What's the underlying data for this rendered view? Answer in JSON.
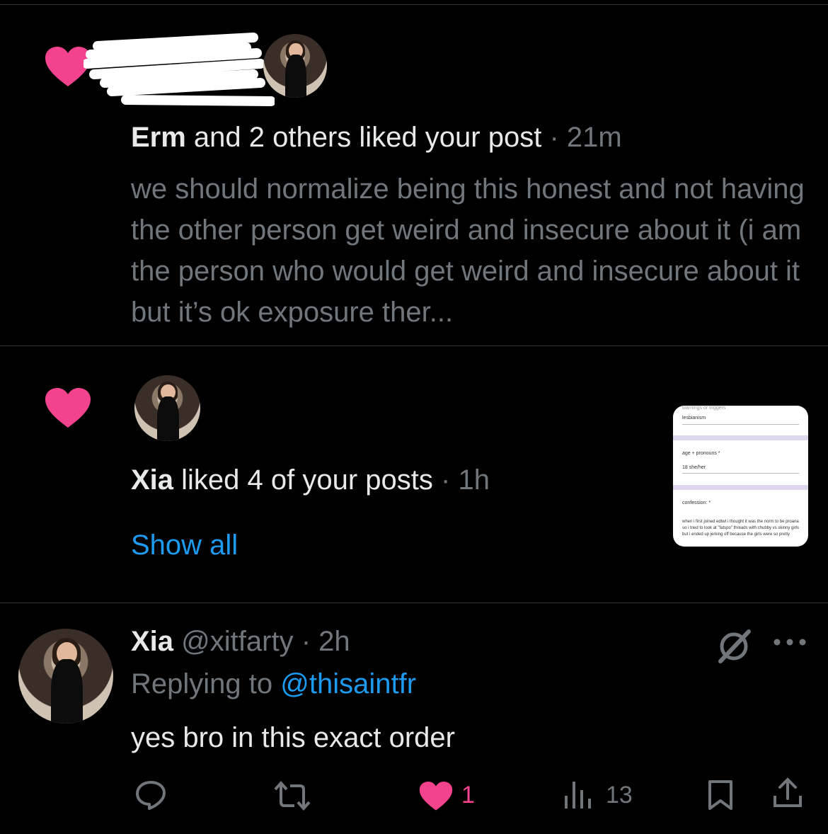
{
  "notifications": [
    {
      "title_name": "Erm",
      "title_rest": " and 2 others liked your post",
      "time_sep": " · ",
      "time": "21m",
      "body": "we should normalize being this honest and not having the other person get weird and insecure about it (i am the person who would get weird and insecure about it but it’s ok exposure ther..."
    },
    {
      "title_name": "Xia",
      "title_rest": " liked 4 of your posts",
      "time_sep": " · ",
      "time": "1h",
      "show_all": "Show all",
      "thumbnail": {
        "header_cut": "warnings or triggers",
        "field1_value": "lesbianism",
        "field2_label": "age + pronouns *",
        "field2_value": "18 she/her",
        "field3_label": "confession: *",
        "field3_value": "when i first joined edtwt i thought it was the norm to be proana so i tried to look at \"fatspo\" threads with chubby vs skinny girls but i ended up jerking off because the girls were so pretty"
      }
    }
  ],
  "reply": {
    "display_name": "Xia",
    "handle": "@xitfarty",
    "time_sep": " · ",
    "time": "2h",
    "replying_prefix": "Replying to ",
    "replying_handle": "@thisaintfr",
    "text": "yes bro in this exact order",
    "actions": {
      "like_count": "1",
      "views_count": "13"
    }
  },
  "colors": {
    "heart": "#f3438f",
    "link": "#1d9bf0",
    "muted": "#71767b",
    "background": "#000000"
  },
  "icons": [
    "heart-icon",
    "reply-icon",
    "retweet-icon",
    "like-icon",
    "views-icon",
    "bookmark-icon",
    "share-icon",
    "more-icon",
    "grok-icon"
  ]
}
